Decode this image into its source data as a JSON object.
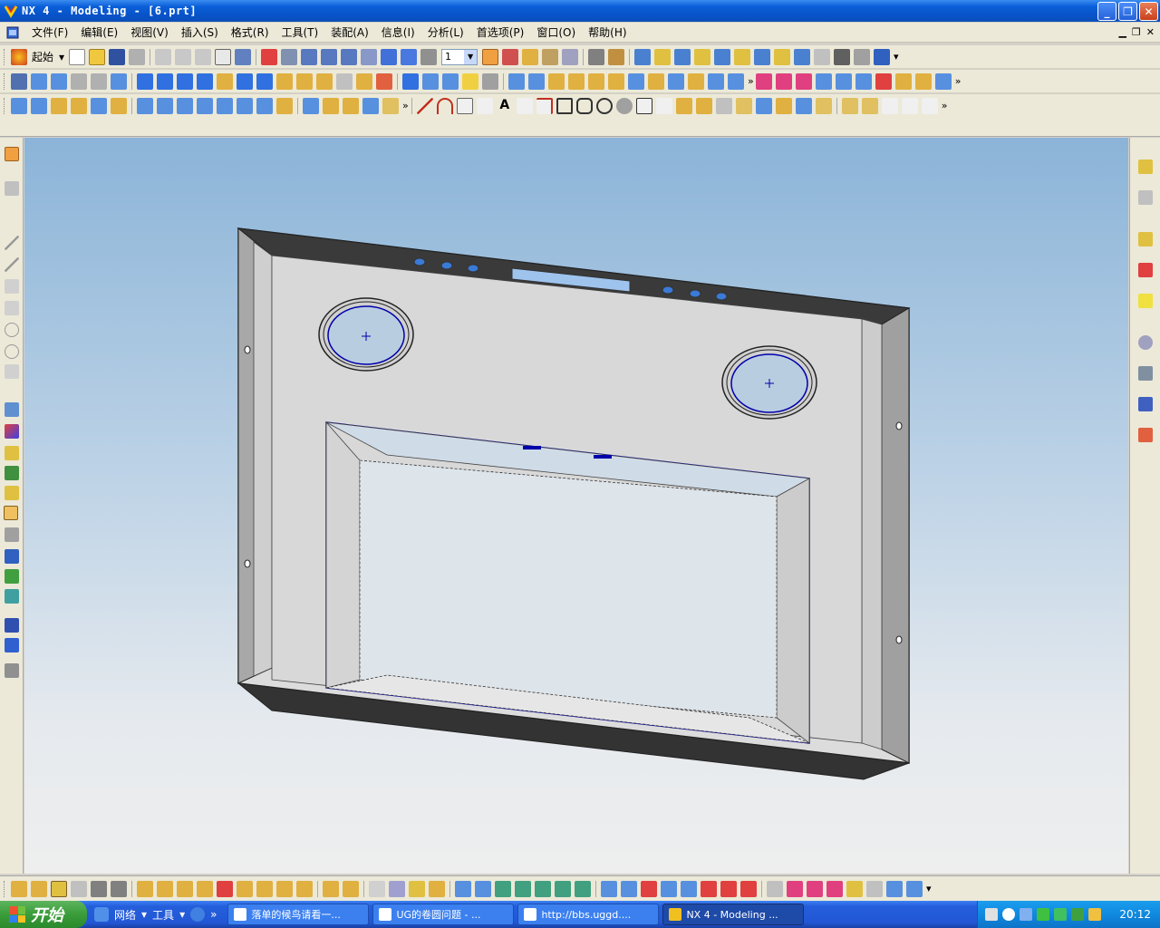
{
  "window": {
    "title": "NX 4 - Modeling - [6.prt]"
  },
  "menu": {
    "items": [
      "文件(F)",
      "编辑(E)",
      "视图(V)",
      "插入(S)",
      "格式(R)",
      "工具(T)",
      "装配(A)",
      "信息(I)",
      "分析(L)",
      "首选项(P)",
      "窗口(O)",
      "帮助(H)"
    ]
  },
  "toolbar": {
    "start_label": "起始",
    "layer_value": "1"
  },
  "taskbar": {
    "start_label": "开始",
    "quick_launch": [
      "网络",
      "工具"
    ],
    "buttons": [
      "落单的候鸟请看一...",
      "UG的卷圆问题 - ...",
      "http://bbs.uggd....",
      "NX 4 - Modeling ..."
    ],
    "clock": "20:12"
  },
  "colors": {
    "titlebar": "#0a5fd8",
    "viewport_top": "#8bb4d8",
    "viewport_bottom": "#eeeeee",
    "model_edge_blue": "#0000aa",
    "model_dark": "#333333"
  }
}
